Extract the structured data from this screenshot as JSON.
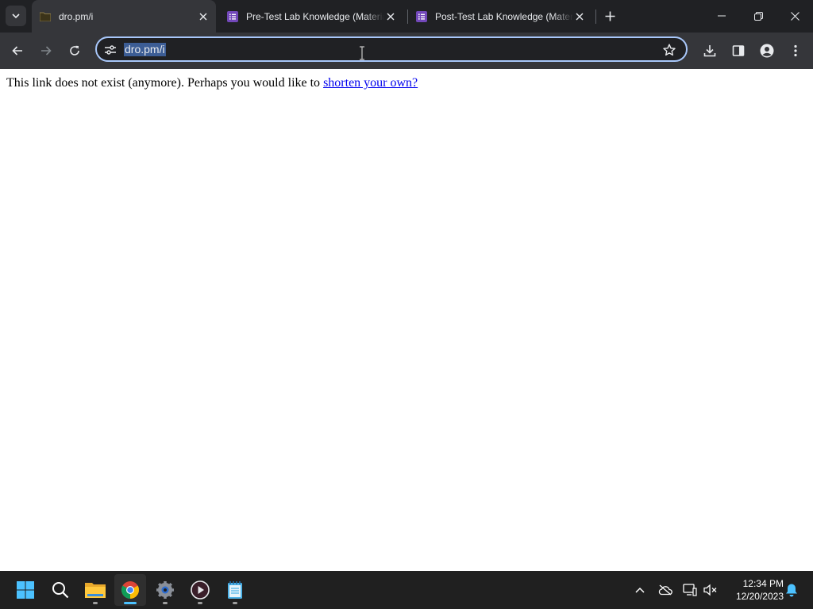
{
  "browser": {
    "tabs": [
      {
        "title": "dro.pm/i",
        "favicon": "folder-favicon",
        "active": true
      },
      {
        "title": "Pre-Test Lab Knowledge (Materials)",
        "favicon": "forms-favicon",
        "active": false
      },
      {
        "title": "Post-Test Lab Knowledge (Materials)",
        "favicon": "forms-favicon",
        "active": false
      }
    ],
    "address_bar": {
      "url": "dro.pm/i",
      "selected": true
    },
    "colors": {
      "frame": "#202124",
      "toolbar": "#35363a",
      "omnibox_border": "#a8c7fa",
      "forms_purple": "#7248b9"
    }
  },
  "page": {
    "message": "This link does not exist (anymore). Perhaps you would like to ",
    "link_text": "shorten your own?"
  },
  "taskbar": {
    "apps": [
      "start-icon",
      "search-icon",
      "file-explorer-icon",
      "chrome-icon",
      "settings-icon",
      "media-player-icon",
      "notepad-icon"
    ],
    "clock": {
      "time": "12:34 PM",
      "date": "12/20/2023"
    }
  }
}
